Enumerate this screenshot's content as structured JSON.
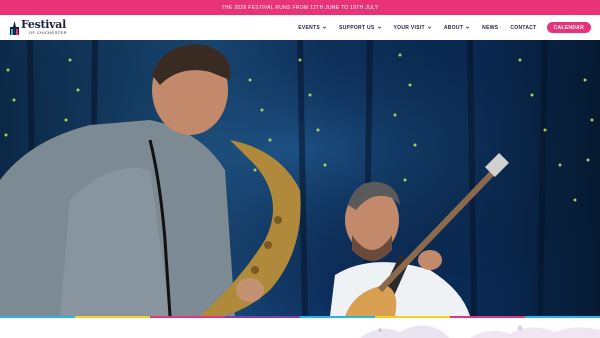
{
  "announcement": {
    "text": "THE 2026 FESTIVAL RUNS FROM 12TH JUNE TO 19TH JULY"
  },
  "logo": {
    "main": "Festival",
    "sub": "OF CHICHESTER"
  },
  "nav": {
    "events": "EVENTS",
    "support": "SUPPORT US",
    "visit": "YOUR VISIT",
    "about": "ABOUT",
    "news": "NEWS",
    "contact": "CONTACT",
    "calendar": "CALENDAR"
  },
  "colors": {
    "accent": "#e8327a",
    "navy": "#1b2240",
    "stripe": [
      "#2bb3e8",
      "#f5d020",
      "#e8327a",
      "#7a3fb0",
      "#2bb3e8",
      "#f5d020",
      "#e8327a",
      "#2bb3e8"
    ]
  },
  "icons": {
    "logo": "cathedral-logo-icon",
    "chevron": "chevron-down-icon"
  }
}
